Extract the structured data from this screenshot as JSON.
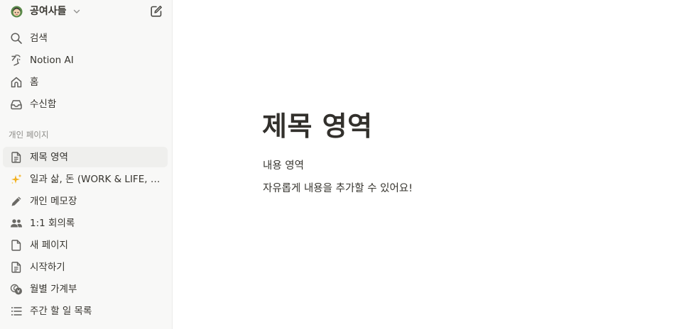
{
  "workspace": {
    "name": "공여사들"
  },
  "nav": {
    "search": "검색",
    "notion_ai": "Notion AI",
    "home": "홈",
    "inbox": "수신함"
  },
  "sidebar": {
    "section_label": "개인 페이지",
    "pages": [
      {
        "label": "제목 영역",
        "icon": "document-icon"
      },
      {
        "label": "일과 삶, 돈 (WORK & LIFE, MONEY)",
        "icon": "sparkles-icon"
      },
      {
        "label": "개인 메모장",
        "icon": "pencil-icon"
      },
      {
        "label": "1:1 회의록",
        "icon": "people-icon"
      },
      {
        "label": "새 페이지",
        "icon": "page-icon"
      },
      {
        "label": "시작하기",
        "icon": "document-icon"
      },
      {
        "label": "월별 가계부",
        "icon": "coins-icon"
      },
      {
        "label": "주간 할 일 목록",
        "icon": "list-icon"
      }
    ]
  },
  "page": {
    "title": "제목 영역",
    "paragraphs": [
      "내용 영역",
      "자유롭게 내용을 추가할 수 있어요!"
    ]
  }
}
